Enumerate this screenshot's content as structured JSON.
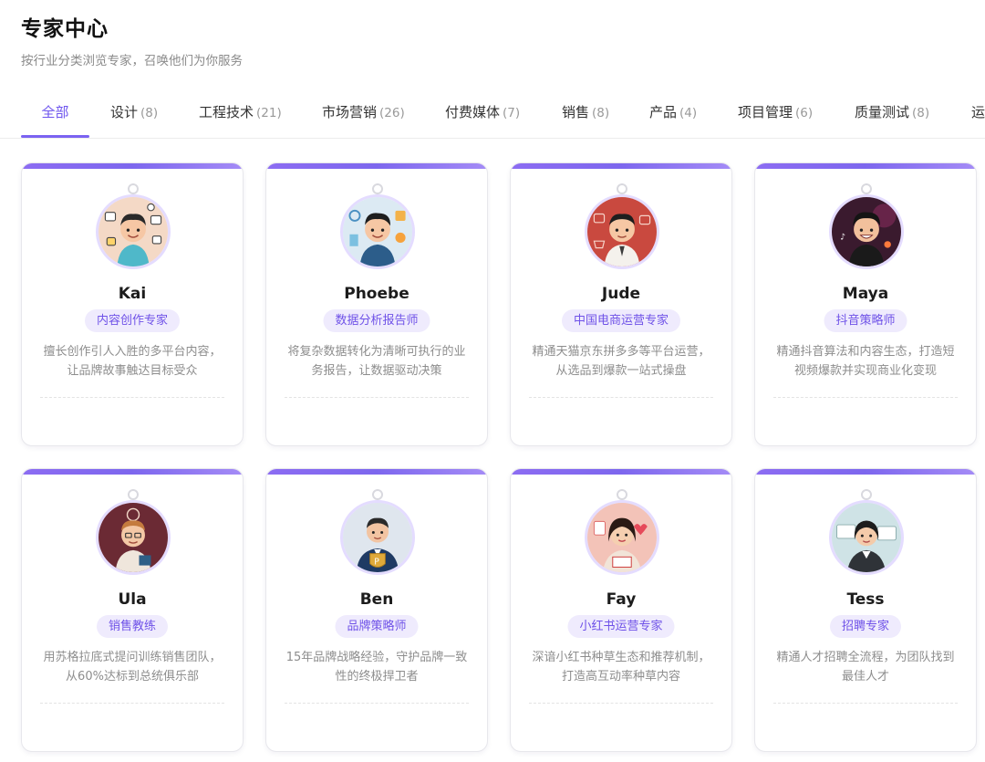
{
  "header": {
    "title": "专家中心",
    "subtitle": "按行业分类浏览专家，召唤他们为你服务"
  },
  "tabs": [
    {
      "label": "全部",
      "count": ""
    },
    {
      "label": "设计",
      "count": "(8)"
    },
    {
      "label": "工程技术",
      "count": "(21)"
    },
    {
      "label": "市场营销",
      "count": "(26)"
    },
    {
      "label": "付费媒体",
      "count": "(7)"
    },
    {
      "label": "销售",
      "count": "(8)"
    },
    {
      "label": "产品",
      "count": "(4)"
    },
    {
      "label": "项目管理",
      "count": "(6)"
    },
    {
      "label": "质量测试",
      "count": "(8)"
    },
    {
      "label": "运",
      "count": ""
    }
  ],
  "colors": {
    "accent": "#7b63f1",
    "badge_bg": "#efebfd",
    "badge_text": "#6f52e8"
  },
  "experts": [
    {
      "name": "Kai",
      "role": "内容创作专家",
      "desc": "擅长创作引人入胜的多平台内容，让品牌故事触达目标受众",
      "avatar": "content-creator-avatar"
    },
    {
      "name": "Phoebe",
      "role": "数据分析报告师",
      "desc": "将复杂数据转化为清晰可执行的业务报告，让数据驱动决策",
      "avatar": "data-analyst-avatar"
    },
    {
      "name": "Jude",
      "role": "中国电商运营专家",
      "desc": "精通天猫京东拼多多等平台运营，从选品到爆款一站式操盘",
      "avatar": "ecommerce-operator-avatar"
    },
    {
      "name": "Maya",
      "role": "抖音策略师",
      "desc": "精通抖音算法和内容生态，打造短视频爆款并实现商业化变现",
      "avatar": "douyin-strategist-avatar"
    },
    {
      "name": "Ula",
      "role": "销售教练",
      "desc": "用苏格拉底式提问训练销售团队，从60%达标到总统俱乐部",
      "avatar": "sales-coach-avatar"
    },
    {
      "name": "Ben",
      "role": "品牌策略师",
      "desc": "15年品牌战略经验，守护品牌一致性的终极捍卫者",
      "avatar": "brand-strategist-avatar"
    },
    {
      "name": "Fay",
      "role": "小红书运营专家",
      "desc": "深谙小红书种草生态和推荐机制，打造高互动率种草内容",
      "avatar": "xiaohongshu-operator-avatar"
    },
    {
      "name": "Tess",
      "role": "招聘专家",
      "desc": "精通人才招聘全流程，为团队找到最佳人才",
      "avatar": "recruiter-avatar"
    }
  ]
}
